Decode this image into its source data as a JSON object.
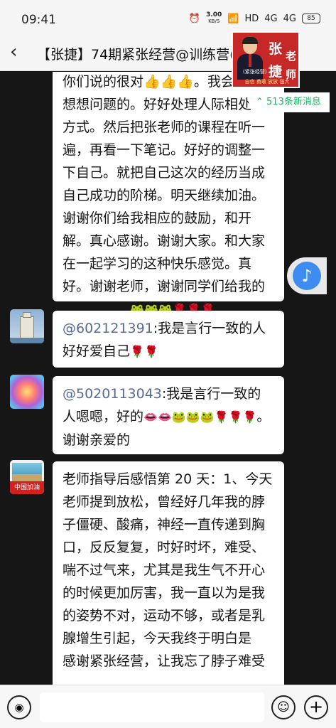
{
  "status": {
    "time": "09:41",
    "speed_value": "3.00",
    "speed_unit": "KB/S",
    "hd": "HD",
    "net1": "4G",
    "net2": "4G",
    "battery": "85"
  },
  "header": {
    "back": "‹",
    "title": "【张捷】74期紧张经营@训练营("
  },
  "promo": {
    "char1": "张",
    "char2": "老",
    "char3": "捷",
    "char4": "师",
    "sub": "(紧张经营)",
    "slogan": "自信 勇敢 放放 强大"
  },
  "new_messages": "⌃ 513条新消息",
  "messages": [
    {
      "text": "你们说的很对👍👍👍。我会好好想想问题的。好好处理人际相处的方式。然后把张老师的课程在听一遍，再看一下笔记。好好的调整一下自己。就把自己这次的经历当成自己成功的阶梯。明天继续加油。谢谢你们给我相应的鼓励，和开解。真心感谢。谢谢大家。和大家在一起学习的这种快乐感觉。真好。谢谢老师，谢谢同学们给我的鼓励和帮助",
      "emojis": "🐸🐸🐸🌹🌹🌹"
    },
    {
      "mention": "@602121391",
      "text": ":我是言行一致的人好好爱自己",
      "emojis": "🌹🌹"
    },
    {
      "mention": "@5020113043",
      "text": ":我是言行一致的人嗯嗯，好的",
      "emojis": "👄👄🐸🐸🐸🌹🌹🌹",
      "tail": "。谢谢亲爱的"
    },
    {
      "avatar_label": "中国加油",
      "text": "老师指导后感悟第 20 天：1、今天老师提到放松，曾经好几年我的脖子僵硬、酸痛，神经一直传递到胸口，反反复复，时好时坏，难受、喘不过气来，尤其是我生气不开心的时候更加厉害，我一直以为是我的姿势不对，运动不够，或者是乳腺增生引起，今天我终于明白是",
      "text2": "感谢紧张经营，让我忘了脖子难受"
    }
  ],
  "colors": {
    "accent": "#07c160",
    "mention": "#576b95",
    "promo": "#c62828",
    "background": "#161616"
  },
  "icons": {
    "music": "♪",
    "voice": "◉",
    "emoji": "☺",
    "plus": "+"
  }
}
